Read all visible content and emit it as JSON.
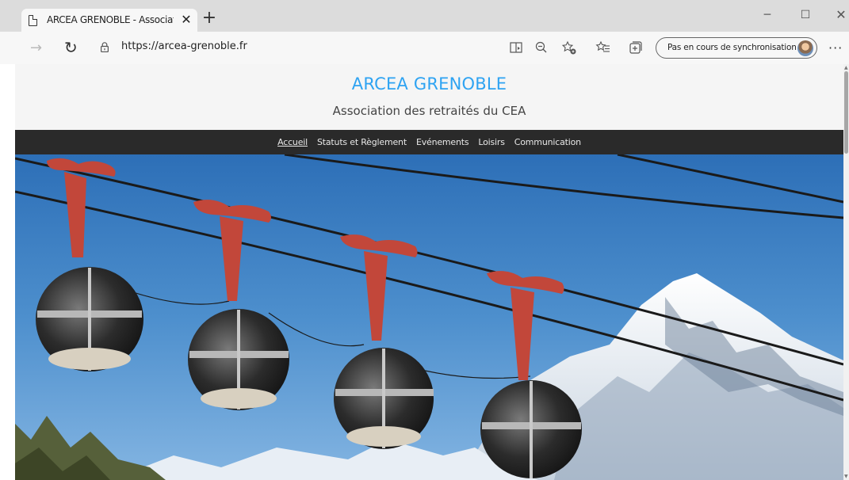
{
  "browser": {
    "tab_title": "ARCEA GRENOBLE - Association",
    "tab_close": "✕",
    "new_tab": "+",
    "url": "https://arcea-grenoble.fr",
    "sync_label": "Pas en cours de synchronisation",
    "more": "···",
    "forward_icon": "→",
    "reload_icon": "↻",
    "minimize": "─",
    "maximize": "☐",
    "close": "✕"
  },
  "site": {
    "title": "ARCEA GRENOBLE",
    "tagline": "Association des retraités du CEA",
    "title_color": "#2ea3f2",
    "nav": [
      {
        "label": "Accueil",
        "current": true
      },
      {
        "label": "Statuts et Règlement",
        "current": false
      },
      {
        "label": "Evénements",
        "current": false
      },
      {
        "label": "Loisirs",
        "current": false
      },
      {
        "label": "Communication",
        "current": false
      }
    ]
  },
  "hero": {
    "image": "cable car bubbles over snowy mountains"
  }
}
